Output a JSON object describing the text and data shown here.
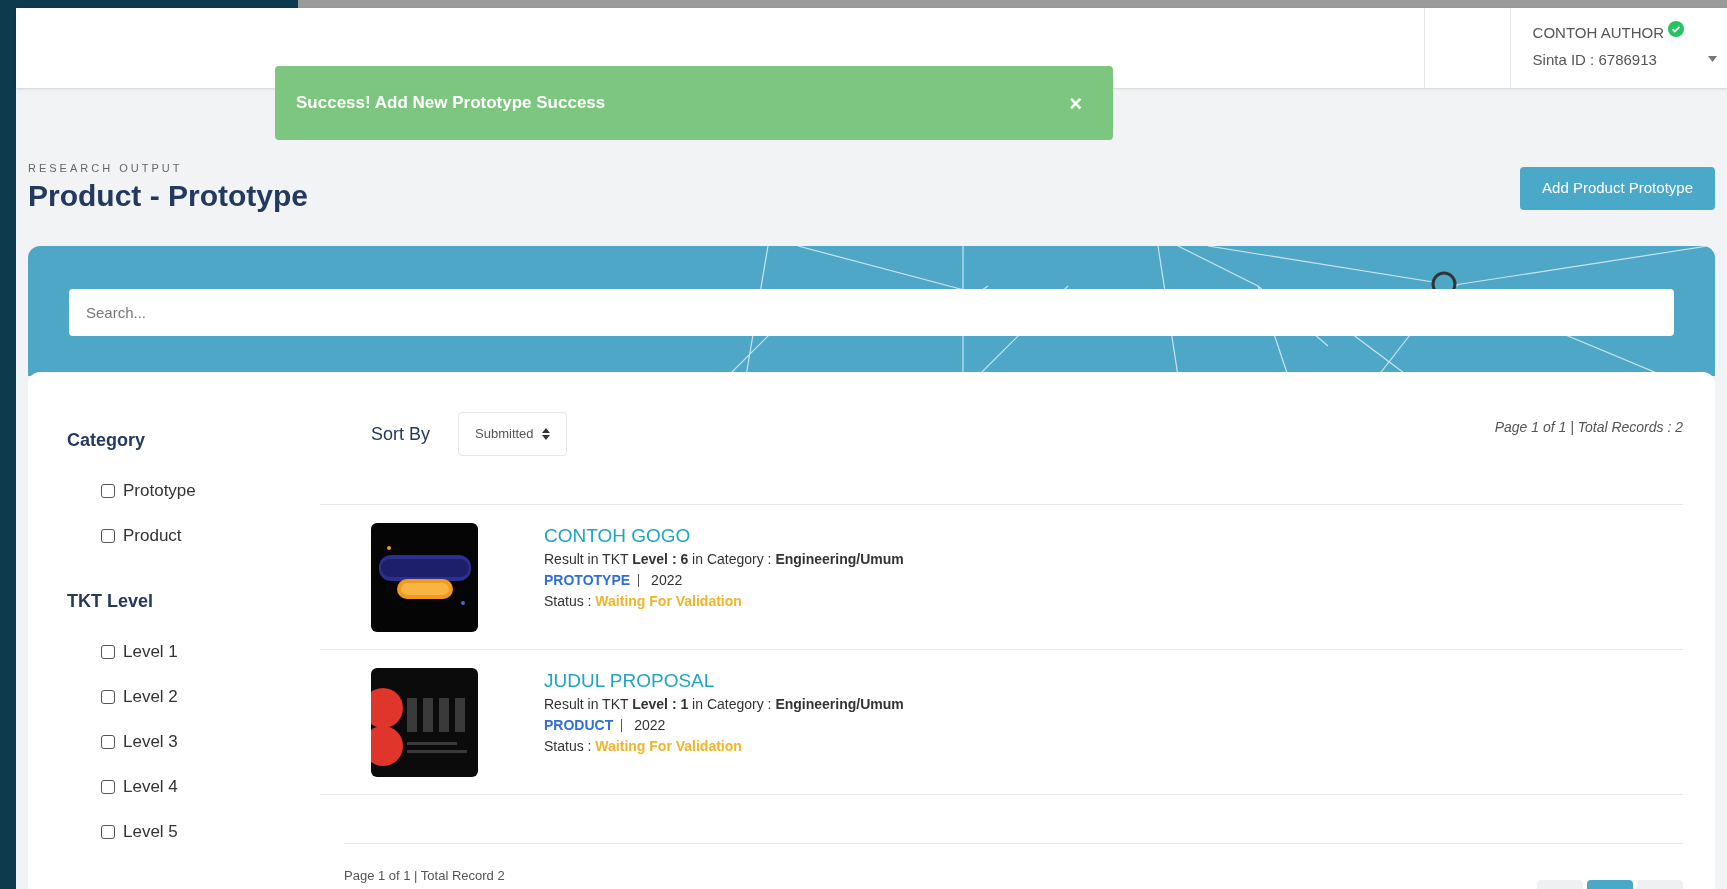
{
  "header": {
    "author_name": "CONTOH AUTHOR",
    "verified": true,
    "sinta_id": "Sinta ID : 6786913"
  },
  "alert": {
    "message": "Success! Add New Prototype Success",
    "close": "×"
  },
  "page": {
    "overline": "RESEARCH OUTPUT",
    "title": "Product - Prototype",
    "add_button": "Add Product Prototype"
  },
  "search": {
    "placeholder": "Search..."
  },
  "filters": [
    {
      "title": "Category",
      "options": [
        {
          "label": "Prototype",
          "checked": false
        },
        {
          "label": "Product",
          "checked": false
        }
      ]
    },
    {
      "title": "TKT Level",
      "options": [
        {
          "label": "Level 1",
          "checked": false
        },
        {
          "label": "Level 2",
          "checked": false
        },
        {
          "label": "Level 3",
          "checked": false
        },
        {
          "label": "Level 4",
          "checked": false
        },
        {
          "label": "Level 5",
          "checked": false
        }
      ]
    }
  ],
  "sort": {
    "label": "Sort By",
    "value": "Submitted"
  },
  "page_info": "Page 1 of 1 | Total Records : 2",
  "results": [
    {
      "title": "CONTOH GOGO",
      "result_prefix": "Result in TKT ",
      "level_label": "Level : 6",
      "category_prefix": " in Category : ",
      "category": "Engineering/Umum",
      "type": "PROTOTYPE",
      "year": "2022",
      "status_label": "Status : ",
      "status": "Waiting For Validation"
    },
    {
      "title": "JUDUL PROPOSAL",
      "result_prefix": "Result in TKT ",
      "level_label": "Level : 1",
      "category_prefix": " in Category : ",
      "category": "Engineering/Umum",
      "type": "PRODUCT",
      "year": "2022",
      "status_label": "Status : ",
      "status": "Waiting For Validation"
    }
  ],
  "footer_info": "Page 1 of 1 | Total Record 2",
  "pagination": [
    {
      "selected": false
    },
    {
      "selected": true
    },
    {
      "selected": false
    }
  ]
}
